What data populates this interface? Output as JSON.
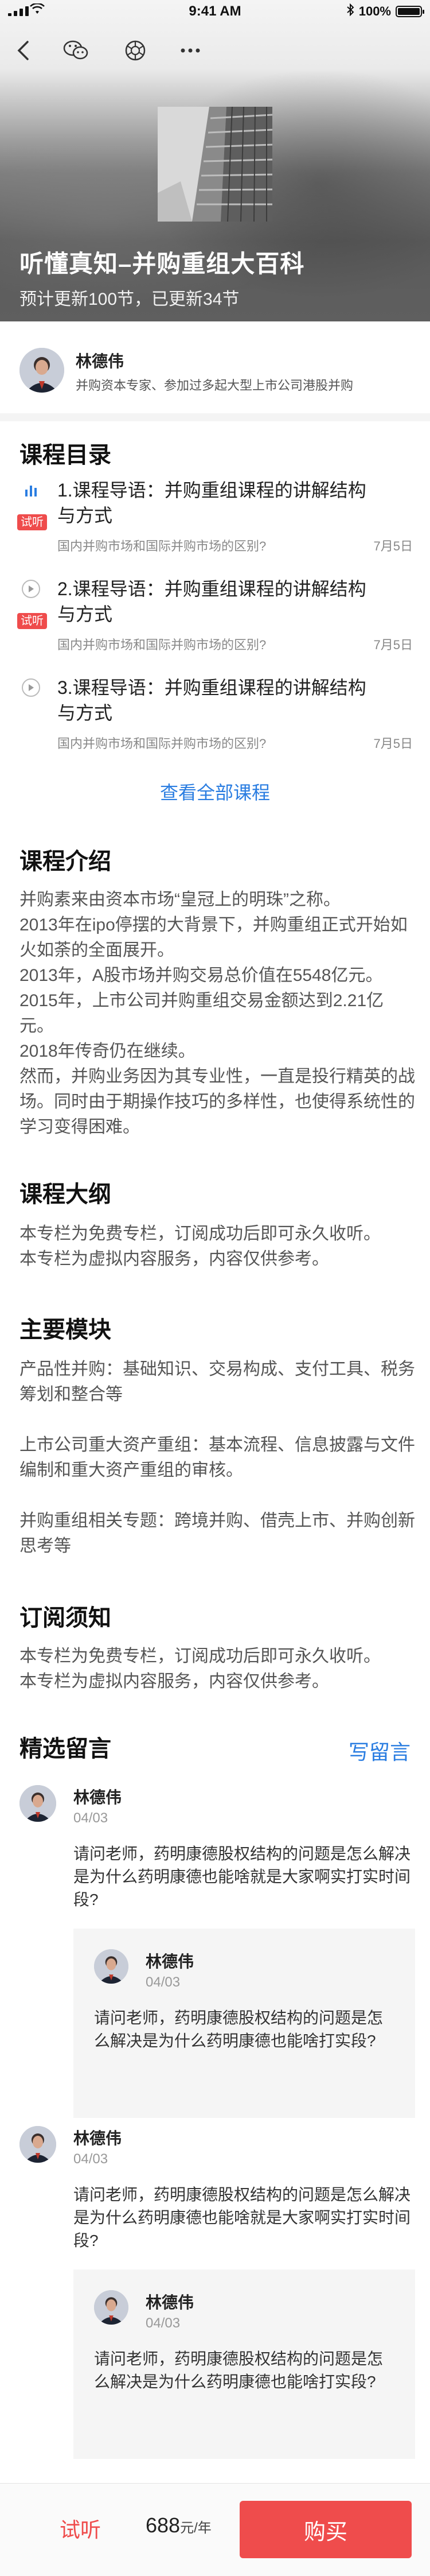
{
  "status_bar": {
    "time": "9:41 AM",
    "battery": "100%"
  },
  "nav": {
    "back_icon": "chevron-left-icon",
    "wechat_icon": "wechat-icon",
    "moments_icon": "moments-icon",
    "more_icon": "more-icon"
  },
  "hero": {
    "title": "听懂真知–并购重组大百科",
    "subtitle": "预计更新100节，已更新34节"
  },
  "author": {
    "name": "林德伟",
    "desc": "并购资本专家、参加过多起大型上市公司港股并购"
  },
  "catalog": {
    "title": "课程目录",
    "tag": "试听",
    "lessons": [
      {
        "title": "1.课程导语：并购重组课程的讲解结构与方式",
        "subtitle": "国内并购市场和国际并购市场的区别?",
        "date": "7月5日"
      },
      {
        "title": "2.课程导语：并购重组课程的讲解结构与方式",
        "subtitle": "国内并购市场和国际并购市场的区别?",
        "date": "7月5日"
      },
      {
        "title": "3.课程导语：并购重组课程的讲解结构与方式",
        "subtitle": "国内并购市场和国际并购市场的区别?",
        "date": "7月5日"
      }
    ],
    "view_all": "查看全部课程"
  },
  "intro": {
    "title": "课程介绍",
    "lines": [
      "并购素来由资本市场“皇冠上的明珠”之称。",
      "2013年在ipo停摆的大背景下，并购重组正式开始如火如荼的全面展开。",
      "2013年，A股市场并购交易总价值在5548亿元。",
      "2015年，上市公司并购重组交易金额达到2.21亿元。",
      "2018年传奇仍在继续。",
      "然而，并购业务因为其专业性，一直是投行精英的战场。同时由于期操作技巧的多样性，也使得系统性的学习变得困难。"
    ]
  },
  "outline": {
    "title": "课程大纲",
    "lines": [
      "本专栏为免费专栏，订阅成功后即可永久收听。",
      "本专栏为虚拟内容服务，内容仅供参考。"
    ]
  },
  "modules": {
    "title": "主要模块",
    "items": [
      "产品性并购：基础知识、交易构成、支付工具、税务筹划和整合等",
      "上市公司重大资产重组：基本流程、信息披露与文件编制和重大资产重组的审核。",
      "并购重组相关专题：跨境并购、借壳上市、并购创新思考等"
    ]
  },
  "notice": {
    "title": "订阅须知",
    "lines": [
      "本专栏为免费专栏，订阅成功后即可永久收听。",
      "本专栏为虚拟内容服务，内容仅供参考。"
    ]
  },
  "comments": {
    "title": "精选留言",
    "write_label": "写留言",
    "items": [
      {
        "name": "林德伟",
        "date": "04/03",
        "text": "请问老师，药明康德股权结构的问题是怎么解决是为什么药明康德也能啥就是大家啊实打实时间段?",
        "reply": {
          "name": "林德伟",
          "date": "04/03",
          "text": "请问老师，药明康德股权结构的问题是怎么解决是为什么药明康德也能啥打实段?"
        }
      },
      {
        "name": "林德伟",
        "date": "04/03",
        "text": "请问老师，药明康德股权结构的问题是怎么解决是为什么药明康德也能啥就是大家啊实打实时间段?",
        "reply": {
          "name": "林德伟",
          "date": "04/03",
          "text": "请问老师，药明康德股权结构的问题是怎么解决是为什么药明康德也能啥打实段?"
        }
      }
    ]
  },
  "bottom_bar": {
    "trial_label": "试听",
    "price": "688",
    "price_unit": "元/年",
    "buy_label": "购买"
  },
  "colors": {
    "accent_red": "#ef4c4c",
    "link_blue": "#2a7de1"
  }
}
